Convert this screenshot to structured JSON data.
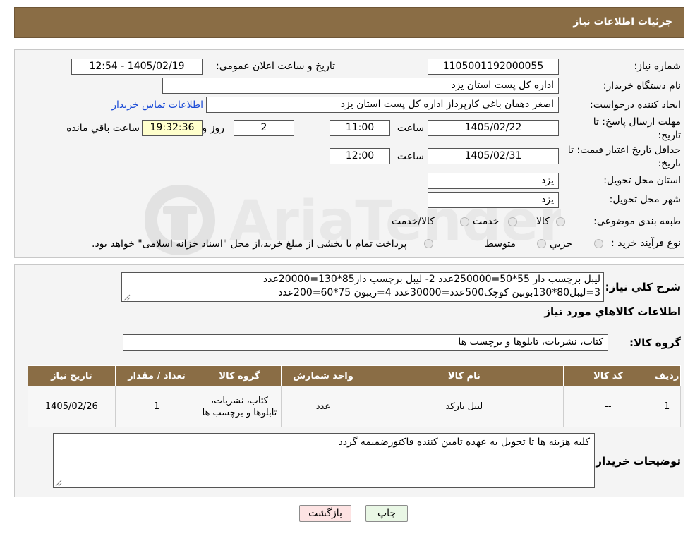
{
  "header": {
    "title": "جزئیات اطلاعات نیاز"
  },
  "form": {
    "need_number_label": "شماره نیاز:",
    "need_number": "1105001192000055",
    "announce_label": "تاریخ و ساعت اعلان عمومی:",
    "announce_value": "1405/02/19 - 12:54",
    "buyer_org_label": "نام دستگاه خریدار:",
    "buyer_org": "اداره کل پست استان یزد",
    "requester_label": "ایجاد کننده درخواست:",
    "requester": "اصغر دهقان باغی کارپرداز اداره کل پست استان یزد",
    "contact_link": "اطلاعات تماس خریدار",
    "deadline_label_1": "مهلت ارسال پاسخ: تا",
    "deadline_label_2": "تاریخ:",
    "deadline_date": "1405/02/22",
    "time_label": "ساعت",
    "deadline_time": "11:00",
    "days_value": "2",
    "days_label": "روز و",
    "remaining_time": "19:32:36",
    "remaining_label": "ساعت باقي مانده",
    "validity_label_1": "حداقل تاریخ اعتبار قیمت: تا",
    "validity_label_2": "تاریخ:",
    "validity_date": "1405/02/31",
    "validity_time": "12:00",
    "province_label": "استان محل تحویل:",
    "province": "یزد",
    "city_label": "شهر محل تحویل:",
    "city": "یزد",
    "category_label": "طبقه بندی موضوعی:",
    "category_options": [
      "کالا",
      "خدمت",
      "کالا/خدمت"
    ],
    "process_label": "نوع فرآیند خرید :",
    "process_options": [
      "جزیي",
      "متوسط"
    ],
    "process_note": "پرداخت تمام یا بخشی از مبلغ خرید،از محل \"اسناد خزانه اسلامی\" خواهد بود."
  },
  "summary": {
    "label": "شرح کلي نیاز:",
    "line1": "لیبل برچسب دار 55*50=250000عدد        2- لیبل برچسب دار85*130=20000عدد",
    "line2": "3=لیبل80*130بوبین کوچک500عدد=30000عدد           4=ریبون 75*60=200عدد",
    "goods_info_title": "اطلاعات کالاهاي مورد نیاز",
    "goods_group_label": "گروه کالا:",
    "goods_group": "کتاب، نشریات، تابلوها و برچسب ها"
  },
  "table": {
    "headers": [
      "ردیف",
      "کد کالا",
      "نام کالا",
      "واحد شمارش",
      "گروه کالا",
      "تعداد / مقدار",
      "تاریخ نیاز"
    ],
    "rows": [
      [
        "1",
        "--",
        "لیبل بارکد",
        "عدد",
        "کتاب، نشریات، تابلوها و برچسب ها",
        "1",
        "1405/02/26"
      ]
    ]
  },
  "buyer_notes": {
    "label": "توضیحات خریدار:",
    "text": "کلیه هزینه ها تا تحویل به عهده تامین کننده فاکتورضمیمه گردد"
  },
  "buttons": {
    "print": "چاپ",
    "back": "بازگشت"
  },
  "colors": {
    "header_bg": "#8a6d45",
    "back_button_bg": "#fde3e3",
    "print_button_bg": "#e9f7e5"
  }
}
